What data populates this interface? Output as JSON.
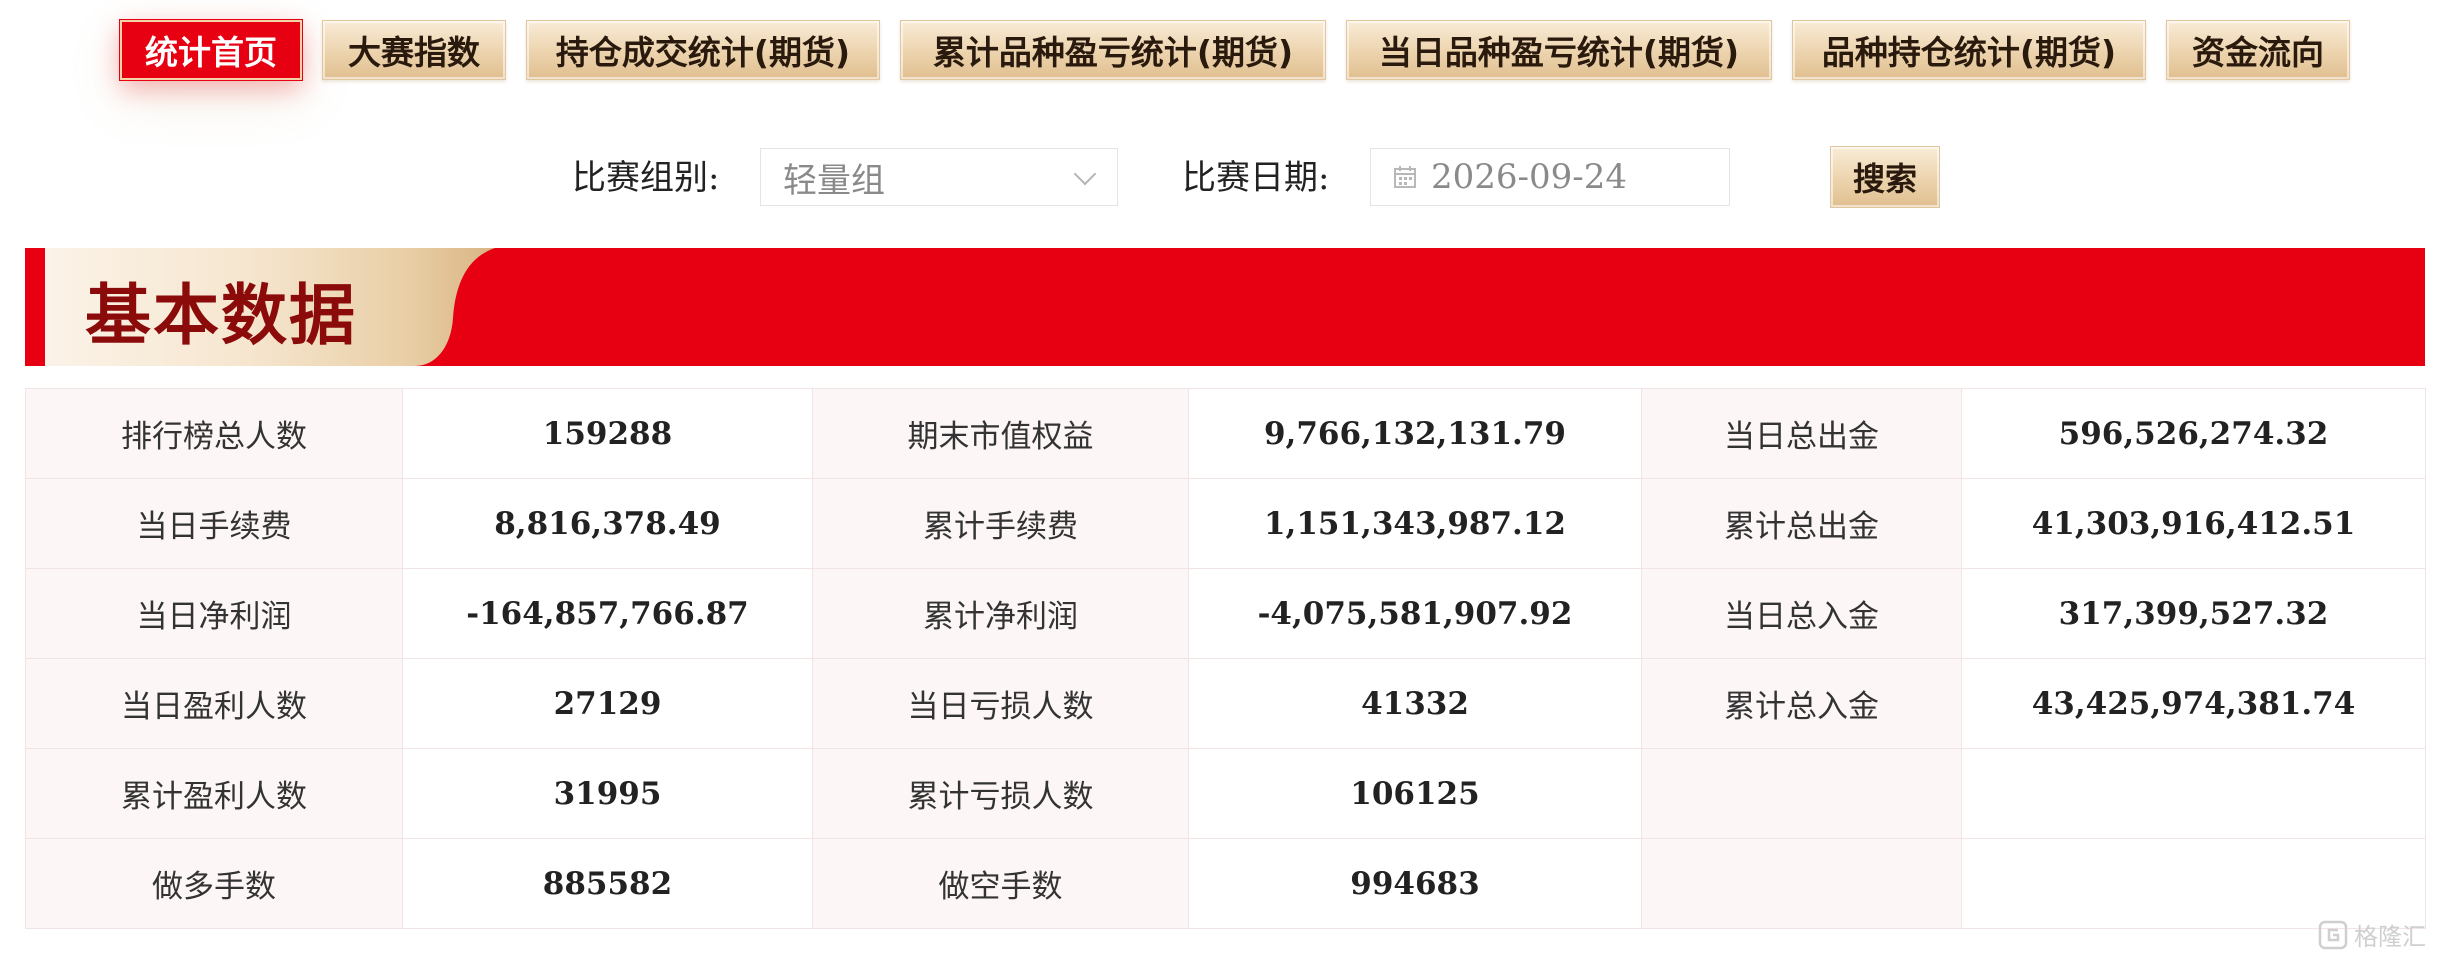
{
  "nav": {
    "tabs": [
      {
        "label": "统计首页",
        "active": true
      },
      {
        "label": "大赛指数",
        "active": false
      },
      {
        "label": "持仓成交统计(期货)",
        "active": false
      },
      {
        "label": "累计品种盈亏统计(期货)",
        "active": false
      },
      {
        "label": "当日品种盈亏统计(期货)",
        "active": false
      },
      {
        "label": "品种持仓统计(期货)",
        "active": false
      },
      {
        "label": "资金流向",
        "active": false
      }
    ]
  },
  "filters": {
    "group_label": "比赛组别:",
    "group_value": "轻量组",
    "date_label": "比赛日期:",
    "date_value": "2026-09-24",
    "search_label": "搜索"
  },
  "section": {
    "title": "基本数据"
  },
  "table": {
    "rows": [
      [
        {
          "label": "排行榜总人数",
          "value": "159288"
        },
        {
          "label": "期末市值权益",
          "value": "9,766,132,131.79"
        },
        {
          "label": "当日总出金",
          "value": "596,526,274.32"
        }
      ],
      [
        {
          "label": "当日手续费",
          "value": "8,816,378.49"
        },
        {
          "label": "累计手续费",
          "value": "1,151,343,987.12"
        },
        {
          "label": "累计总出金",
          "value": "41,303,916,412.51"
        }
      ],
      [
        {
          "label": "当日净利润",
          "value": "-164,857,766.87"
        },
        {
          "label": "累计净利润",
          "value": "-4,075,581,907.92"
        },
        {
          "label": "当日总入金",
          "value": "317,399,527.32"
        }
      ],
      [
        {
          "label": "当日盈利人数",
          "value": "27129"
        },
        {
          "label": "当日亏损人数",
          "value": "41332"
        },
        {
          "label": "累计总入金",
          "value": "43,425,974,381.74"
        }
      ],
      [
        {
          "label": "累计盈利人数",
          "value": "31995"
        },
        {
          "label": "累计亏损人数",
          "value": "106125"
        },
        {
          "label": "",
          "value": ""
        }
      ],
      [
        {
          "label": "做多手数",
          "value": "885582"
        },
        {
          "label": "做空手数",
          "value": "994683"
        },
        {
          "label": "",
          "value": ""
        }
      ]
    ]
  },
  "watermark": {
    "text": "格隆汇"
  },
  "colors": {
    "accent_red": "#e60012",
    "gold": "#ecd3ad",
    "title_red": "#8b0a0a"
  },
  "icons": {
    "select_caret": "chevron-down-icon",
    "date": "calendar-icon",
    "watermark_logo": "gelonghui-logo-icon"
  }
}
